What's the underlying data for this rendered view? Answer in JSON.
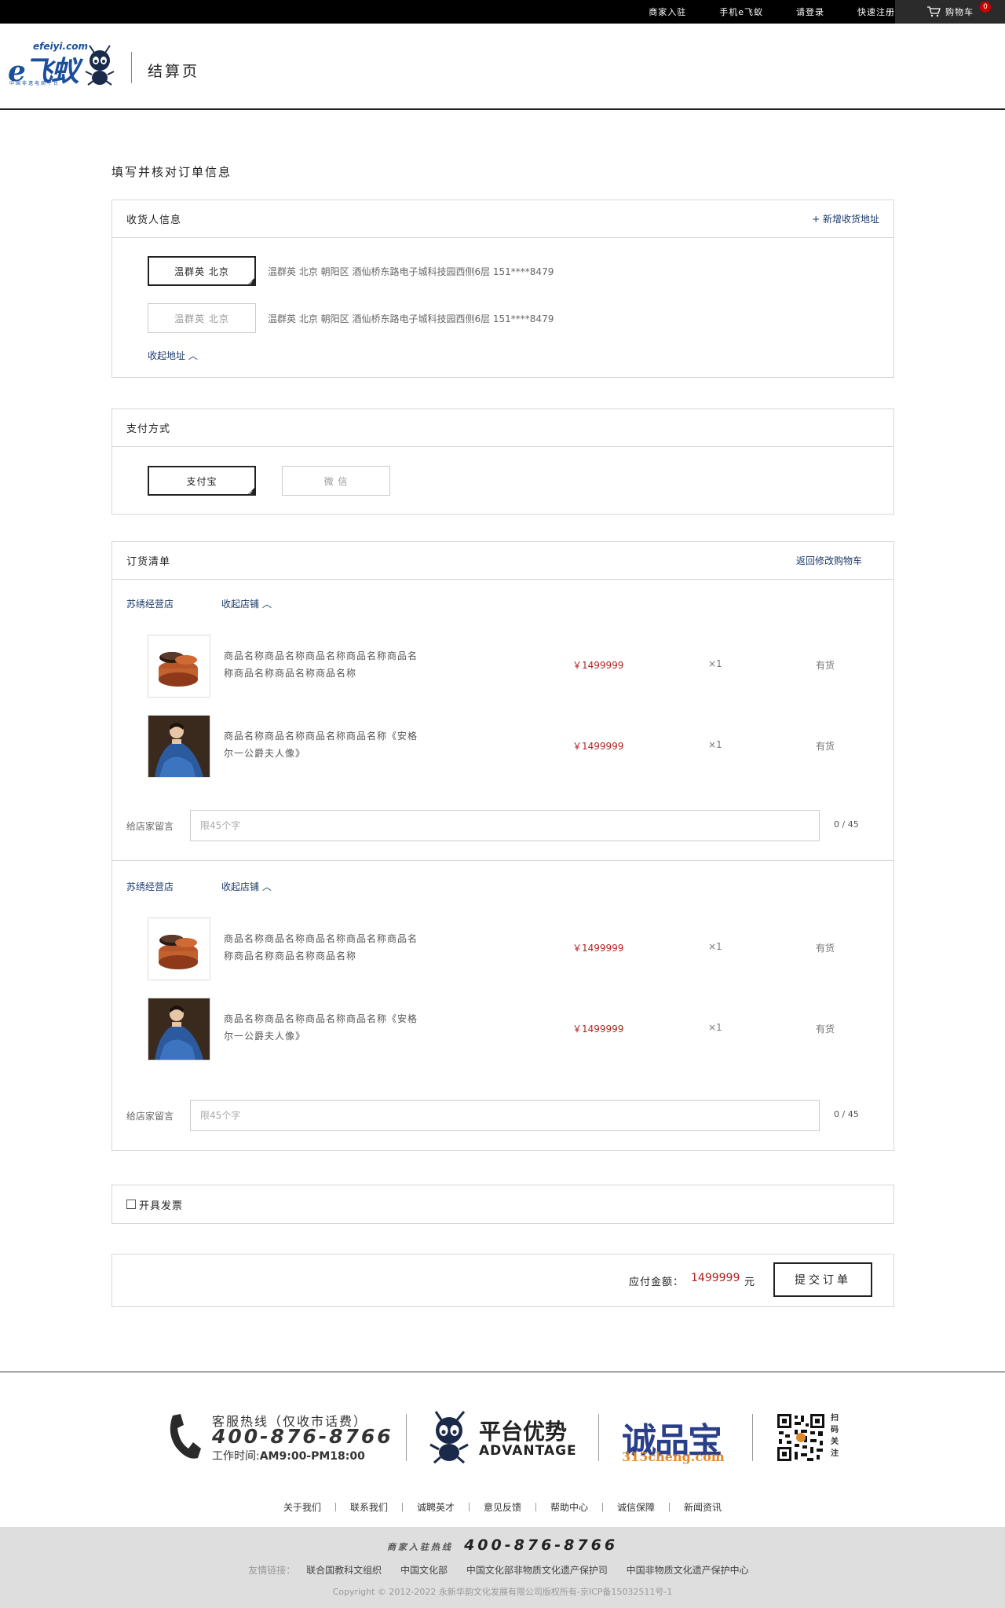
{
  "topbar": {
    "links": [
      "商家入驻",
      "手机e飞蚁",
      "请登录",
      "快速注册"
    ],
    "cart_label": "购物车",
    "cart_count": "0"
  },
  "header": {
    "logo_site": "efeiyi.com",
    "logo_brand": "e飞蚁",
    "logo_slogan": "中国非遗电商平台",
    "page_title": "结算页"
  },
  "page_heading": "填写并核对订单信息",
  "consignee": {
    "title": "收货人信息",
    "add_label": "+ 新增收货地址",
    "addresses": [
      {
        "name": "温群英  北京",
        "detail": "温群英   北京   朝阳区   酒仙桥东路电子城科技园西侧6层   151****8479",
        "selected": true
      },
      {
        "name": "温群英  北京",
        "detail": "温群英   北京   朝阳区   酒仙桥东路电子城科技园西侧6层   151****8479",
        "selected": false
      }
    ],
    "collapse_label": "收起地址 ︿"
  },
  "payment": {
    "title": "支付方式",
    "options": [
      {
        "label": "支付宝",
        "selected": true
      },
      {
        "label": "微   信",
        "selected": false
      }
    ]
  },
  "order": {
    "title": "订货清单",
    "back_label": "返回修改购物车",
    "shops": [
      {
        "name": "苏绣经营店",
        "collapse_label": "收起店铺 ︿",
        "items": [
          {
            "thumb": "bowl",
            "name": "商品名称商品名称商品名称商品名称商品名称商品名称商品名称商品名称",
            "price": "￥1499999",
            "qty": "×1",
            "stock": "有货"
          },
          {
            "thumb": "portrait",
            "name": "商品名称商品名称商品名称商品名称《安格尔一公爵夫人像》",
            "price": "￥1499999",
            "qty": "×1",
            "stock": "有货"
          }
        ],
        "msg_label": "给店家留言",
        "msg_placeholder": "限45个字",
        "msg_count": "0 / 45"
      },
      {
        "name": "苏绣经营店",
        "collapse_label": "收起店铺 ︿",
        "items": [
          {
            "thumb": "bowl",
            "name": "商品名称商品名称商品名称商品名称商品名称商品名称商品名称商品名称",
            "price": "￥1499999",
            "qty": "×1",
            "stock": "有货"
          },
          {
            "thumb": "portrait",
            "name": "商品名称商品名称商品名称商品名称《安格尔一公爵夫人像》",
            "price": "￥1499999",
            "qty": "×1",
            "stock": "有货"
          }
        ],
        "msg_label": "给店家留言",
        "msg_placeholder": "限45个字",
        "msg_count": "0 / 45"
      }
    ]
  },
  "invoice": {
    "label": "开具发票",
    "checked": false
  },
  "summary": {
    "label": "应付金额：",
    "amount": "1499999",
    "unit": "元",
    "submit_label": "提交订单"
  },
  "footer": {
    "hotline_label": "客服热线（仅收市话费）",
    "hotline_number": "400-876-8766",
    "hours_label": "工作时间:",
    "hours_value": "AM9:00-PM18:00",
    "advantage_cn": "平台优势",
    "advantage_en": "ADVANTAGE",
    "chengpinbao": "诚品宝",
    "chengpinbao_url": "315cheng.com",
    "qr_label": "扫码关注",
    "links": [
      "关于我们",
      "联系我们",
      "诚聘英才",
      "意见反馈",
      "帮助中心",
      "诚信保障",
      "新闻资讯"
    ],
    "merchant_hotline_label": "商家入驻热线",
    "merchant_hotline": "400-876-8766",
    "friend_label": "友情链接：",
    "friends": [
      "联合国教科文组织",
      "中国文化部",
      "中国文化部非物质文化遗产保护司",
      "中国非物质文化遗产保护中心"
    ],
    "copyright": "Copyright © 2012-2022 永新华韵文化发展有限公司版权所有-京ICP备15032511号-1"
  },
  "colors": {
    "price": "#b22222",
    "link": "#1b3a6b",
    "brand": "#1b4f9c"
  }
}
